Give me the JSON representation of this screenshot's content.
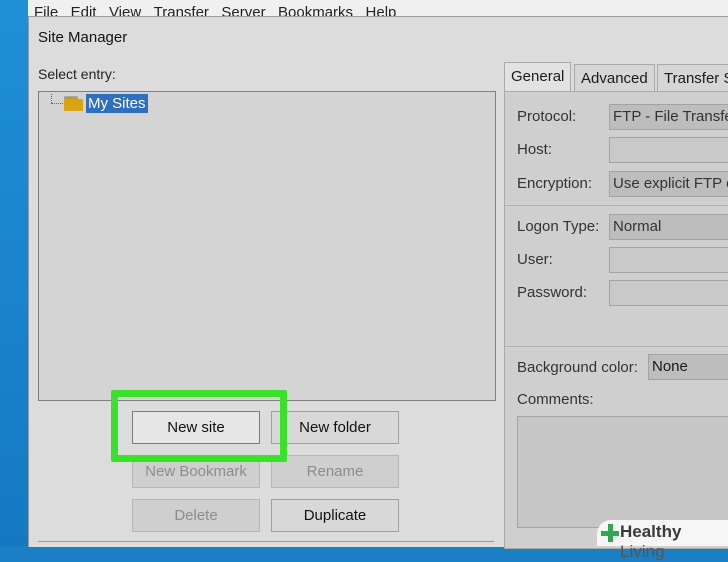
{
  "menubar": {
    "items": [
      "File",
      "Edit",
      "View",
      "Transfer",
      "Server",
      "Bookmarks",
      "Help"
    ]
  },
  "dialog": {
    "title": "Site Manager",
    "select_entry_label": "Select entry:",
    "tree": {
      "root": {
        "label": "My Sites",
        "icon": "folder-icon",
        "selected": true
      }
    },
    "buttons": {
      "new_site": "New site",
      "new_folder": "New folder",
      "new_bookmark": "New Bookmark",
      "rename": "Rename",
      "delete": "Delete",
      "duplicate": "Duplicate"
    }
  },
  "tabs": [
    "General",
    "Advanced",
    "Transfer S"
  ],
  "general": {
    "protocol_label": "Protocol:",
    "protocol_value": "FTP - File Transfe",
    "host_label": "Host:",
    "host_value": "",
    "encryption_label": "Encryption:",
    "encryption_value": "Use explicit FTP o",
    "logon_type_label": "Logon Type:",
    "logon_type_value": "Normal",
    "user_label": "User:",
    "user_value": "",
    "password_label": "Password:",
    "password_value": "",
    "background_color_label": "Background color:",
    "background_color_value": "None",
    "comments_label": "Comments:"
  },
  "watermark": {
    "brand_bold": "Healthy",
    "brand_light": " Living"
  },
  "colors": {
    "highlight": "#39e12b",
    "selection": "#2f6fbf",
    "folder": "#d9a412",
    "desktop": "#1a7fc4"
  }
}
